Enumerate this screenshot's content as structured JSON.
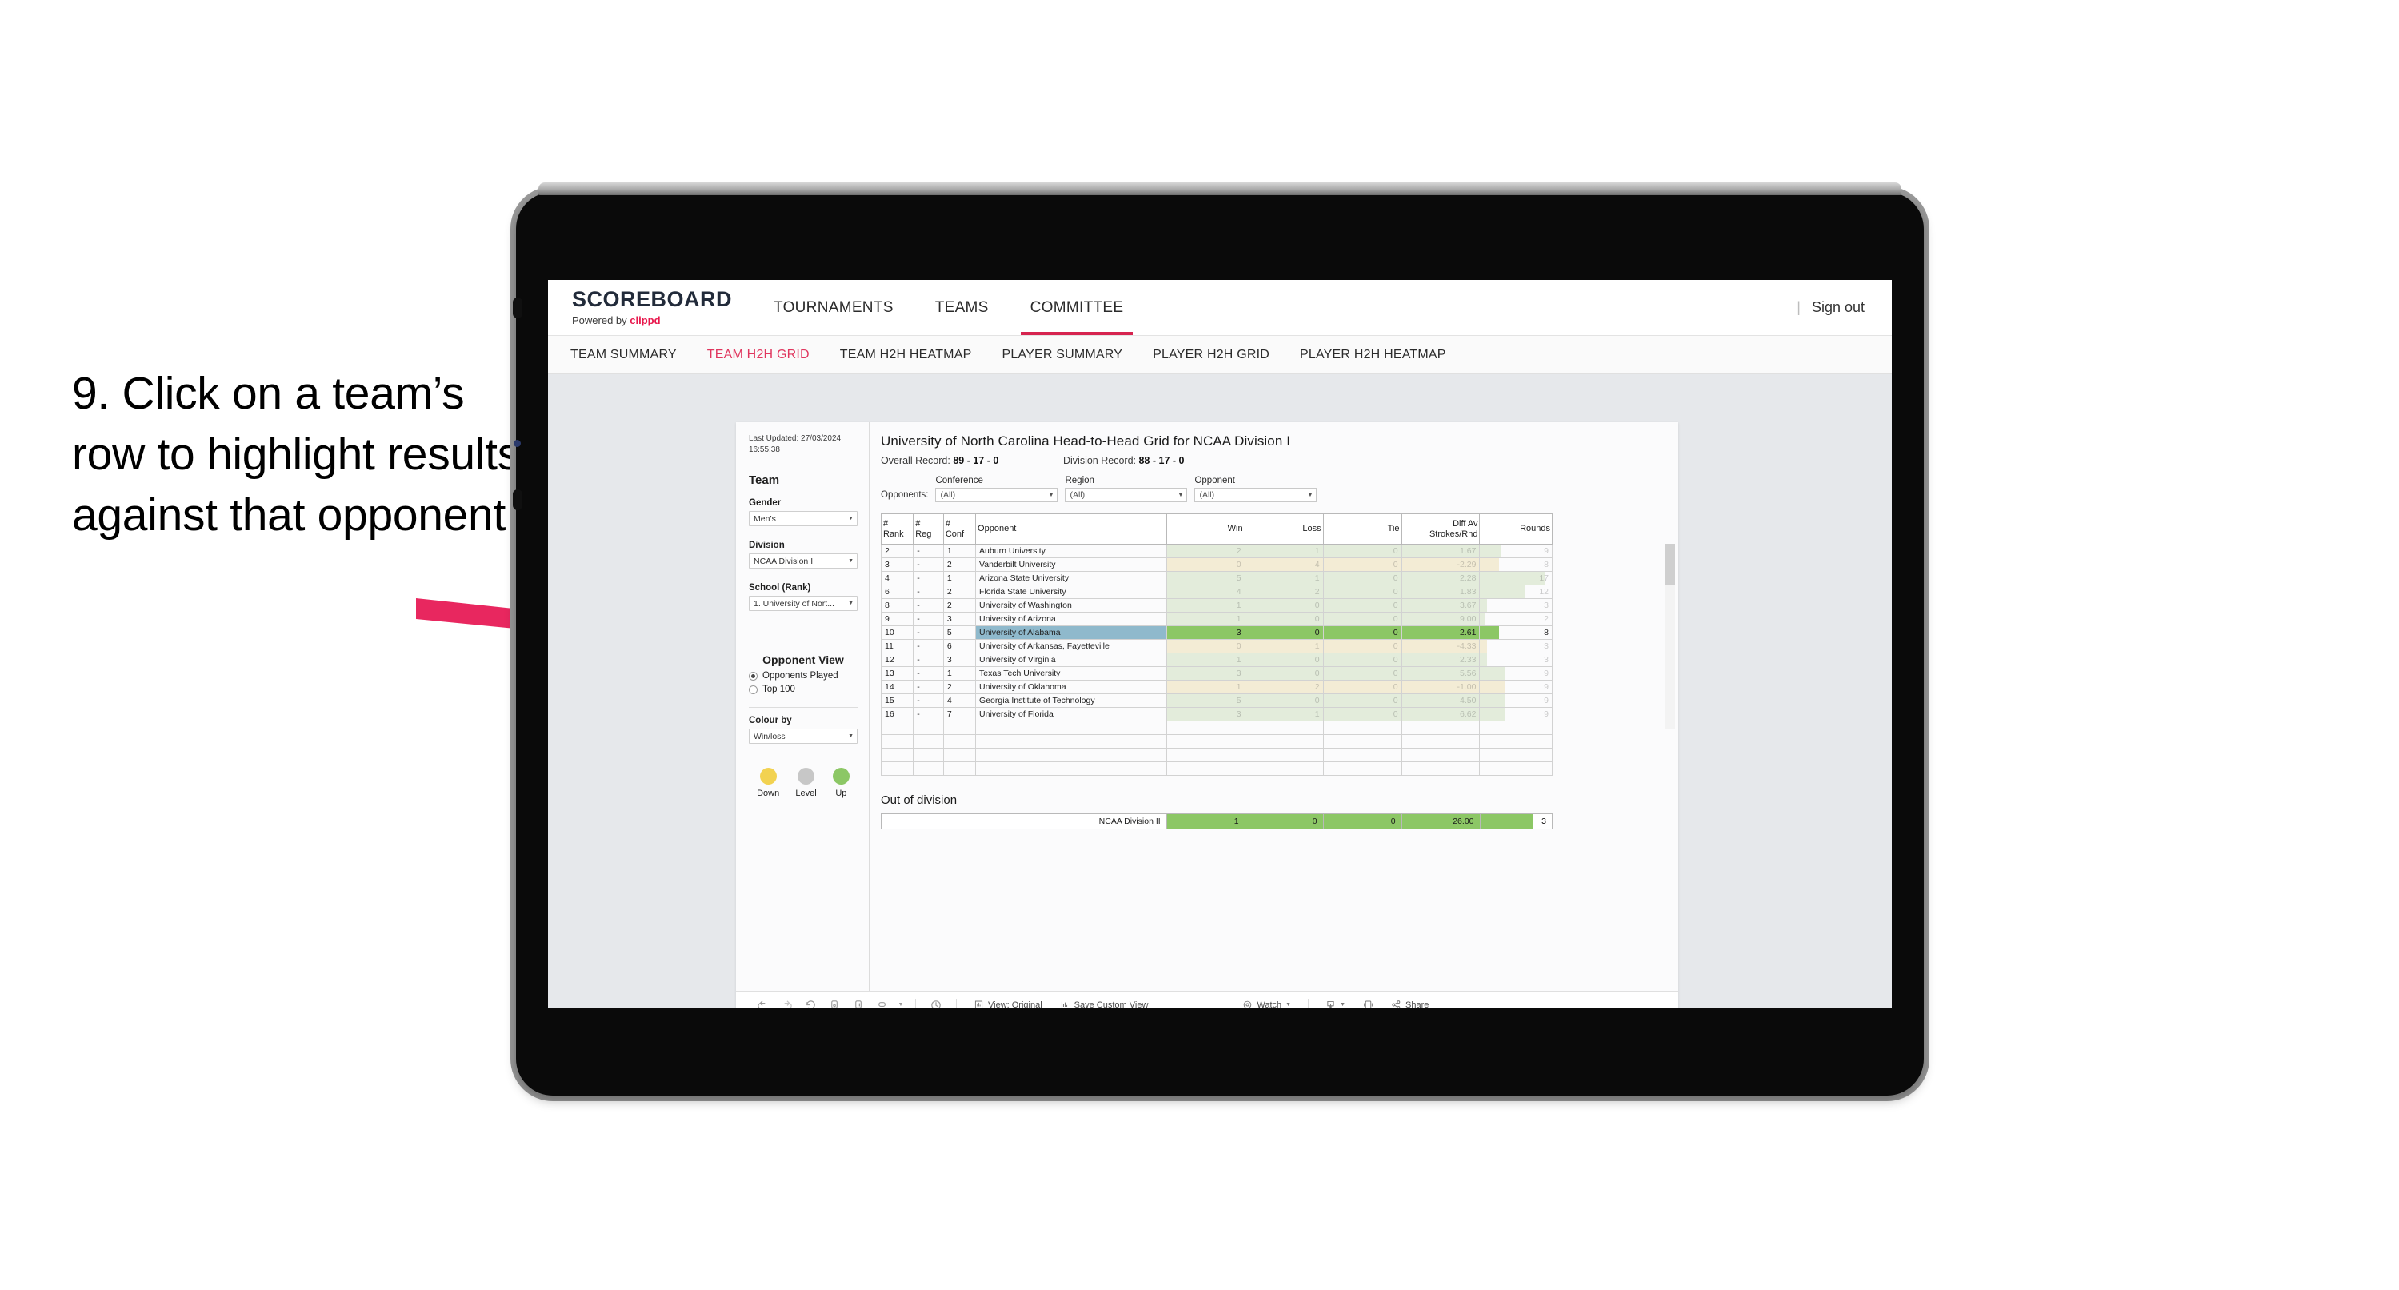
{
  "caption": {
    "text": "9. Click on a team’s row to highlight results against that opponent"
  },
  "topnav": {
    "brand_name": "SCOREBOARD",
    "brand_powered": "Powered by ",
    "brand_clippd": "clippd",
    "items": [
      {
        "label": "TOURNAMENTS",
        "active": false
      },
      {
        "label": "TEAMS",
        "active": false
      },
      {
        "label": "COMMITTEE",
        "active": true
      }
    ],
    "separator": "|",
    "signout": "Sign out"
  },
  "subnav": {
    "items": [
      {
        "label": "TEAM SUMMARY",
        "active": false
      },
      {
        "label": "TEAM H2H GRID",
        "active": true
      },
      {
        "label": "TEAM H2H HEATMAP",
        "active": false
      },
      {
        "label": "PLAYER SUMMARY",
        "active": false
      },
      {
        "label": "PLAYER H2H GRID",
        "active": false
      },
      {
        "label": "PLAYER H2H HEATMAP",
        "active": false
      }
    ]
  },
  "sidebar": {
    "last_updated": "Last Updated: 27/03/2024 16:55:38",
    "team_title": "Team",
    "gender_label": "Gender",
    "gender_value": "Men’s",
    "division_label": "Division",
    "division_value": "NCAA Division I",
    "school_label": "School (Rank)",
    "school_value": "1. University of Nort...",
    "opponent_view_title": "Opponent View",
    "opponent_view_options": [
      {
        "label": "Opponents Played",
        "selected": true
      },
      {
        "label": "Top 100",
        "selected": false
      }
    ],
    "colour_by_label": "Colour by",
    "colour_by_value": "Win/loss",
    "legend": [
      {
        "label": "Down",
        "color": "#f2d251"
      },
      {
        "label": "Level",
        "color": "#c7c7c7"
      },
      {
        "label": "Up",
        "color": "#8cc765"
      }
    ]
  },
  "viz": {
    "title": "University of North Carolina Head-to-Head Grid for NCAA Division I",
    "overall_record_label": "Overall Record: ",
    "overall_record_value": "89 - 17 - 0",
    "division_record_label": "Division Record: ",
    "division_record_value": "88 - 17 - 0",
    "opponents_label": "Opponents:",
    "filters": [
      {
        "label": "Conference",
        "value": "(All)"
      },
      {
        "label": "Region",
        "value": "(All)"
      },
      {
        "label": "Opponent",
        "value": "(All)"
      }
    ],
    "columns": [
      {
        "line1": "#",
        "line2": "Rank"
      },
      {
        "line1": "#",
        "line2": "Reg"
      },
      {
        "line1": "#",
        "line2": "Conf"
      },
      {
        "line1": "Opponent",
        "line2": ""
      },
      {
        "line1": "Win",
        "line2": ""
      },
      {
        "line1": "Loss",
        "line2": ""
      },
      {
        "line1": "Tie",
        "line2": ""
      },
      {
        "line1": "Diff Av",
        "line2": "Strokes/Rnd"
      },
      {
        "line1": "Rounds",
        "line2": ""
      }
    ],
    "rows": [
      {
        "rank": "2",
        "reg": "-",
        "conf": "1",
        "opponent": "Auburn University",
        "win": "2",
        "loss": "1",
        "tie": "0",
        "diff": "1.67",
        "rounds": "9",
        "tone": "up",
        "selected": false,
        "bar": 0.3
      },
      {
        "rank": "3",
        "reg": "-",
        "conf": "2",
        "opponent": "Vanderbilt University",
        "win": "0",
        "loss": "4",
        "tie": "0",
        "diff": "-2.29",
        "rounds": "8",
        "tone": "down",
        "selected": false,
        "bar": 0.26
      },
      {
        "rank": "4",
        "reg": "-",
        "conf": "1",
        "opponent": "Arizona State University",
        "win": "5",
        "loss": "1",
        "tie": "0",
        "diff": "2.28",
        "rounds": "17",
        "tone": "up",
        "selected": false,
        "bar": 0.9
      },
      {
        "rank": "6",
        "reg": "-",
        "conf": "2",
        "opponent": "Florida State University",
        "win": "4",
        "loss": "2",
        "tie": "0",
        "diff": "1.83",
        "rounds": "12",
        "tone": "up",
        "selected": false,
        "bar": 0.62
      },
      {
        "rank": "8",
        "reg": "-",
        "conf": "2",
        "opponent": "University of Washington",
        "win": "1",
        "loss": "0",
        "tie": "0",
        "diff": "3.67",
        "rounds": "3",
        "tone": "up",
        "selected": false,
        "bar": 0.1
      },
      {
        "rank": "9",
        "reg": "-",
        "conf": "3",
        "opponent": "University of Arizona",
        "win": "1",
        "loss": "0",
        "tie": "0",
        "diff": "9.00",
        "rounds": "2",
        "tone": "up",
        "selected": false,
        "bar": 0.07
      },
      {
        "rank": "10",
        "reg": "-",
        "conf": "5",
        "opponent": "University of Alabama",
        "win": "3",
        "loss": "0",
        "tie": "0",
        "diff": "2.61",
        "rounds": "8",
        "tone": "up",
        "selected": true,
        "bar": 0.26
      },
      {
        "rank": "11",
        "reg": "-",
        "conf": "6",
        "opponent": "University of Arkansas, Fayetteville",
        "win": "0",
        "loss": "1",
        "tie": "0",
        "diff": "-4.33",
        "rounds": "3",
        "tone": "down",
        "selected": false,
        "bar": 0.1
      },
      {
        "rank": "12",
        "reg": "-",
        "conf": "3",
        "opponent": "University of Virginia",
        "win": "1",
        "loss": "0",
        "tie": "0",
        "diff": "2.33",
        "rounds": "3",
        "tone": "up",
        "selected": false,
        "bar": 0.1
      },
      {
        "rank": "13",
        "reg": "-",
        "conf": "1",
        "opponent": "Texas Tech University",
        "win": "3",
        "loss": "0",
        "tie": "0",
        "diff": "5.56",
        "rounds": "9",
        "tone": "up",
        "selected": false,
        "bar": 0.34
      },
      {
        "rank": "14",
        "reg": "-",
        "conf": "2",
        "opponent": "University of Oklahoma",
        "win": "1",
        "loss": "2",
        "tie": "0",
        "diff": "-1.00",
        "rounds": "9",
        "tone": "down",
        "selected": false,
        "bar": 0.34
      },
      {
        "rank": "15",
        "reg": "-",
        "conf": "4",
        "opponent": "Georgia Institute of Technology",
        "win": "5",
        "loss": "0",
        "tie": "0",
        "diff": "4.50",
        "rounds": "9",
        "tone": "up",
        "selected": false,
        "bar": 0.34
      },
      {
        "rank": "16",
        "reg": "-",
        "conf": "7",
        "opponent": "University of Florida",
        "win": "3",
        "loss": "1",
        "tie": "0",
        "diff": "6.62",
        "rounds": "9",
        "tone": "up",
        "selected": false,
        "bar": 0.34
      }
    ],
    "out_of_division_title": "Out of division",
    "out_of_division_row": {
      "name": "NCAA Division II",
      "win": "1",
      "loss": "0",
      "tie": "0",
      "diff": "26.00",
      "rounds": "3"
    }
  },
  "toolbar": {
    "view_original": "View: Original",
    "save_custom_view": "Save Custom View",
    "watch": "Watch",
    "share": "Share",
    "caret": "▾"
  },
  "colors": {
    "accent_pink": "#d6244f",
    "arrow_pink": "#e8275f",
    "selected_blue": "#8fb9cc",
    "green": "#8cc765",
    "green_pale": "#e3ecdb",
    "amber_pale": "#f3ecd5",
    "yellow": "#f2d251"
  }
}
